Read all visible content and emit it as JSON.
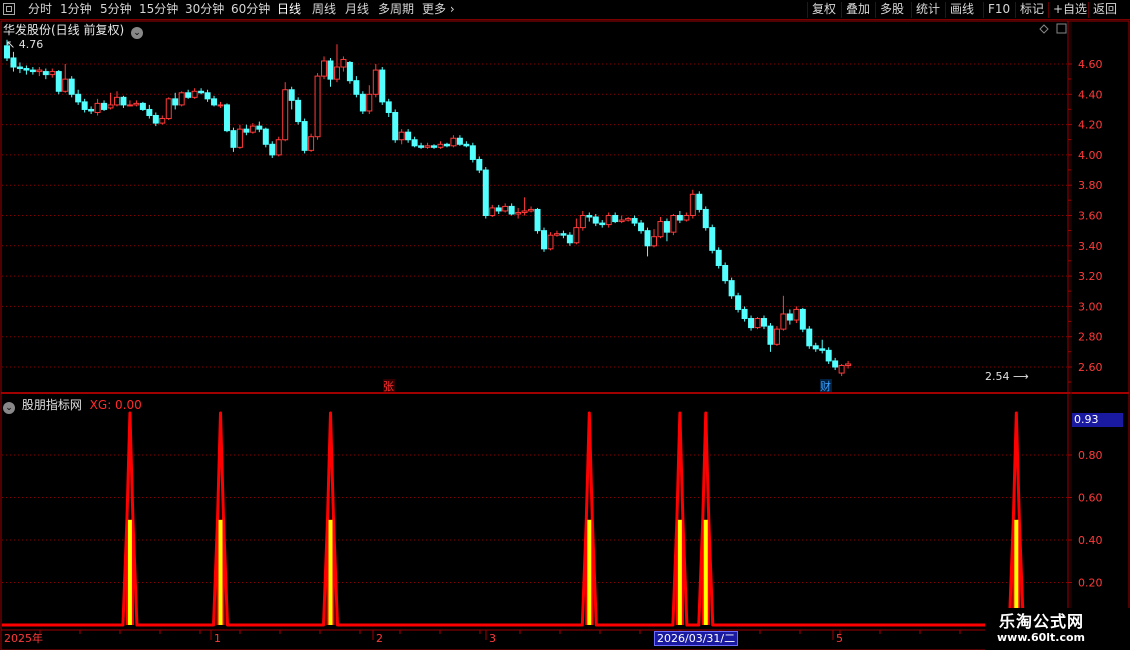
{
  "toolbar": {
    "left": [
      "分时",
      "1分钟",
      "5分钟",
      "15分钟",
      "30分钟",
      "60分钟",
      "日线",
      "周线",
      "月线",
      "多周期",
      "更多"
    ],
    "active": "日线",
    "right": [
      "复权",
      "叠加",
      "多股",
      "统计",
      "画线",
      "F10",
      "标记",
      "+自选",
      "返回"
    ]
  },
  "main_chart": {
    "title": "华发股份(日线 前复权)",
    "high_label": "4.76",
    "low_label": "2.54",
    "y_ticks": [
      "4.60",
      "4.40",
      "4.20",
      "4.00",
      "3.80",
      "3.60",
      "3.40",
      "3.20",
      "3.00",
      "2.80",
      "2.60"
    ],
    "markers": [
      {
        "text": "张",
        "color": "#ff3030"
      },
      {
        "text": "财",
        "color": "#3aa0ff"
      }
    ]
  },
  "indicator": {
    "name": "股朋指标网",
    "value_label": "XG: 0.00",
    "current_value": "0.93",
    "y_ticks": [
      "0.80",
      "0.60",
      "0.40",
      "0.20"
    ]
  },
  "date_axis": {
    "start": "2025年",
    "ticks": [
      "1",
      "2",
      "3",
      "5"
    ],
    "cursor_date": "2026/03/31/二"
  },
  "watermark": {
    "line1": "乐淘公式网",
    "line2": "www.60lt.com"
  },
  "colors": {
    "up": "#ff3a3a",
    "down": "#54ffff",
    "axis": "#a00000",
    "spike": "#ff0000",
    "bar_fill": "#ffff00"
  },
  "chart_data": {
    "type": "candlestick",
    "ylim": [
      2.5,
      4.76
    ],
    "candles": [
      [
        4.72,
        4.64,
        4.76,
        4.62
      ],
      [
        4.64,
        4.58,
        4.68,
        4.55
      ],
      [
        4.58,
        4.57,
        4.61,
        4.54
      ],
      [
        4.57,
        4.56,
        4.59,
        4.53
      ],
      [
        4.56,
        4.55,
        4.58,
        4.53
      ],
      [
        4.55,
        4.56,
        4.58,
        4.52
      ],
      [
        4.55,
        4.53,
        4.57,
        4.5
      ],
      [
        4.53,
        4.55,
        4.57,
        4.51
      ],
      [
        4.55,
        4.42,
        4.56,
        4.4
      ],
      [
        4.42,
        4.5,
        4.6,
        4.41
      ],
      [
        4.5,
        4.4,
        4.52,
        4.38
      ],
      [
        4.4,
        4.35,
        4.43,
        4.33
      ],
      [
        4.35,
        4.3,
        4.37,
        4.28
      ],
      [
        4.3,
        4.29,
        4.32,
        4.27
      ],
      [
        4.28,
        4.34,
        4.37,
        4.26
      ],
      [
        4.34,
        4.3,
        4.36,
        4.29
      ],
      [
        4.31,
        4.33,
        4.41,
        4.3
      ],
      [
        4.33,
        4.38,
        4.42,
        4.32
      ],
      [
        4.38,
        4.33,
        4.39,
        4.31
      ],
      [
        4.33,
        4.33,
        4.36,
        4.32
      ],
      [
        4.33,
        4.34,
        4.36,
        4.32
      ],
      [
        4.34,
        4.3,
        4.35,
        4.29
      ],
      [
        4.3,
        4.26,
        4.33,
        4.24
      ],
      [
        4.26,
        4.21,
        4.28,
        4.19
      ],
      [
        4.21,
        4.24,
        4.26,
        4.2
      ],
      [
        4.24,
        4.37,
        4.38,
        4.23
      ],
      [
        4.37,
        4.33,
        4.41,
        4.3
      ],
      [
        4.33,
        4.41,
        4.42,
        4.32
      ],
      [
        4.41,
        4.38,
        4.43,
        4.37
      ],
      [
        4.38,
        4.42,
        4.44,
        4.37
      ],
      [
        4.42,
        4.41,
        4.44,
        4.4
      ],
      [
        4.41,
        4.37,
        4.43,
        4.35
      ],
      [
        4.37,
        4.33,
        4.39,
        4.32
      ],
      [
        4.33,
        4.33,
        4.35,
        4.31
      ],
      [
        4.33,
        4.16,
        4.34,
        4.15
      ],
      [
        4.16,
        4.05,
        4.18,
        4.02
      ],
      [
        4.05,
        4.17,
        4.2,
        4.04
      ],
      [
        4.17,
        4.15,
        4.2,
        4.13
      ],
      [
        4.15,
        4.19,
        4.21,
        4.14
      ],
      [
        4.19,
        4.17,
        4.22,
        4.15
      ],
      [
        4.17,
        4.07,
        4.18,
        4.05
      ],
      [
        4.07,
        4.0,
        4.09,
        3.98
      ],
      [
        4.0,
        4.1,
        4.12,
        3.99
      ],
      [
        4.1,
        4.43,
        4.48,
        4.09
      ],
      [
        4.43,
        4.36,
        4.45,
        4.3
      ],
      [
        4.36,
        4.22,
        4.38,
        4.2
      ],
      [
        4.22,
        4.03,
        4.24,
        4.01
      ],
      [
        4.03,
        4.12,
        4.14,
        4.02
      ],
      [
        4.12,
        4.52,
        4.54,
        4.1
      ],
      [
        4.52,
        4.62,
        4.65,
        4.5
      ],
      [
        4.62,
        4.5,
        4.64,
        4.45
      ],
      [
        4.5,
        4.58,
        4.73,
        4.48
      ],
      [
        4.58,
        4.63,
        4.65,
        4.55
      ],
      [
        4.61,
        4.49,
        4.62,
        4.47
      ],
      [
        4.49,
        4.4,
        4.52,
        4.38
      ],
      [
        4.4,
        4.29,
        4.42,
        4.27
      ],
      [
        4.29,
        4.4,
        4.46,
        4.27
      ],
      [
        4.4,
        4.56,
        4.6,
        4.38
      ],
      [
        4.56,
        4.35,
        4.58,
        4.33
      ],
      [
        4.35,
        4.28,
        4.37,
        4.25
      ],
      [
        4.28,
        4.1,
        4.3,
        4.08
      ],
      [
        4.1,
        4.15,
        4.17,
        4.07
      ],
      [
        4.15,
        4.1,
        4.17,
        4.08
      ],
      [
        4.1,
        4.06,
        4.12,
        4.05
      ],
      [
        4.06,
        4.05,
        4.08,
        4.04
      ],
      [
        4.05,
        4.06,
        4.08,
        4.04
      ],
      [
        4.06,
        4.05,
        4.07,
        4.04
      ],
      [
        4.05,
        4.07,
        4.09,
        4.04
      ],
      [
        4.07,
        4.06,
        4.08,
        4.05
      ],
      [
        4.06,
        4.11,
        4.13,
        4.05
      ],
      [
        4.11,
        4.07,
        4.13,
        4.06
      ],
      [
        4.07,
        4.06,
        4.09,
        4.05
      ],
      [
        4.06,
        3.97,
        4.08,
        3.95
      ],
      [
        3.97,
        3.9,
        3.99,
        3.88
      ],
      [
        3.9,
        3.6,
        3.92,
        3.58
      ],
      [
        3.6,
        3.65,
        3.67,
        3.59
      ],
      [
        3.65,
        3.63,
        3.67,
        3.61
      ],
      [
        3.63,
        3.66,
        3.68,
        3.62
      ],
      [
        3.66,
        3.61,
        3.68,
        3.6
      ],
      [
        3.61,
        3.62,
        3.65,
        3.58
      ],
      [
        3.62,
        3.63,
        3.72,
        3.6
      ],
      [
        3.63,
        3.64,
        3.66,
        3.62
      ],
      [
        3.64,
        3.5,
        3.65,
        3.48
      ],
      [
        3.5,
        3.38,
        3.52,
        3.36
      ],
      [
        3.38,
        3.47,
        3.49,
        3.37
      ],
      [
        3.47,
        3.48,
        3.5,
        3.46
      ],
      [
        3.48,
        3.47,
        3.5,
        3.45
      ],
      [
        3.47,
        3.42,
        3.49,
        3.4
      ],
      [
        3.42,
        3.52,
        3.58,
        3.41
      ],
      [
        3.52,
        3.6,
        3.63,
        3.5
      ],
      [
        3.6,
        3.59,
        3.62,
        3.56
      ],
      [
        3.59,
        3.55,
        3.61,
        3.53
      ],
      [
        3.55,
        3.54,
        3.57,
        3.52
      ],
      [
        3.54,
        3.6,
        3.62,
        3.52
      ],
      [
        3.6,
        3.56,
        3.62,
        3.55
      ],
      [
        3.56,
        3.57,
        3.6,
        3.55
      ],
      [
        3.57,
        3.58,
        3.59,
        3.56
      ],
      [
        3.58,
        3.55,
        3.6,
        3.53
      ],
      [
        3.55,
        3.5,
        3.57,
        3.48
      ],
      [
        3.5,
        3.4,
        3.52,
        3.33
      ],
      [
        3.4,
        3.46,
        3.51,
        3.39
      ],
      [
        3.46,
        3.56,
        3.59,
        3.45
      ],
      [
        3.56,
        3.49,
        3.58,
        3.43
      ],
      [
        3.49,
        3.6,
        3.61,
        3.47
      ],
      [
        3.6,
        3.57,
        3.63,
        3.55
      ],
      [
        3.57,
        3.6,
        3.62,
        3.56
      ],
      [
        3.6,
        3.74,
        3.77,
        3.58
      ],
      [
        3.74,
        3.64,
        3.76,
        3.62
      ],
      [
        3.64,
        3.52,
        3.66,
        3.5
      ],
      [
        3.52,
        3.37,
        3.54,
        3.35
      ],
      [
        3.37,
        3.27,
        3.39,
        3.25
      ],
      [
        3.27,
        3.17,
        3.29,
        3.15
      ],
      [
        3.17,
        3.07,
        3.19,
        3.05
      ],
      [
        3.07,
        2.98,
        3.09,
        2.96
      ],
      [
        2.98,
        2.92,
        3.0,
        2.9
      ],
      [
        2.92,
        2.86,
        2.94,
        2.84
      ],
      [
        2.86,
        2.92,
        2.93,
        2.85
      ],
      [
        2.92,
        2.87,
        2.94,
        2.85
      ],
      [
        2.87,
        2.75,
        2.89,
        2.7
      ],
      [
        2.75,
        2.85,
        2.87,
        2.74
      ],
      [
        2.85,
        2.95,
        3.07,
        2.84
      ],
      [
        2.95,
        2.91,
        2.98,
        2.88
      ],
      [
        2.91,
        2.98,
        3.0,
        2.89
      ],
      [
        2.98,
        2.85,
        2.99,
        2.83
      ],
      [
        2.85,
        2.74,
        2.87,
        2.72
      ],
      [
        2.74,
        2.72,
        2.76,
        2.7
      ],
      [
        2.72,
        2.71,
        2.78,
        2.69
      ],
      [
        2.71,
        2.64,
        2.73,
        2.62
      ],
      [
        2.64,
        2.6,
        2.66,
        2.58
      ],
      [
        2.56,
        2.61,
        2.62,
        2.54
      ],
      [
        2.61,
        2.62,
        2.64,
        2.59
      ]
    ],
    "xg_signal_days": [
      19,
      33,
      50,
      90,
      104,
      108,
      156
    ],
    "xg_spike_value": 1.0,
    "xg_bar_value": 0.5,
    "indicator_ylim": [
      0,
      1.0
    ]
  }
}
